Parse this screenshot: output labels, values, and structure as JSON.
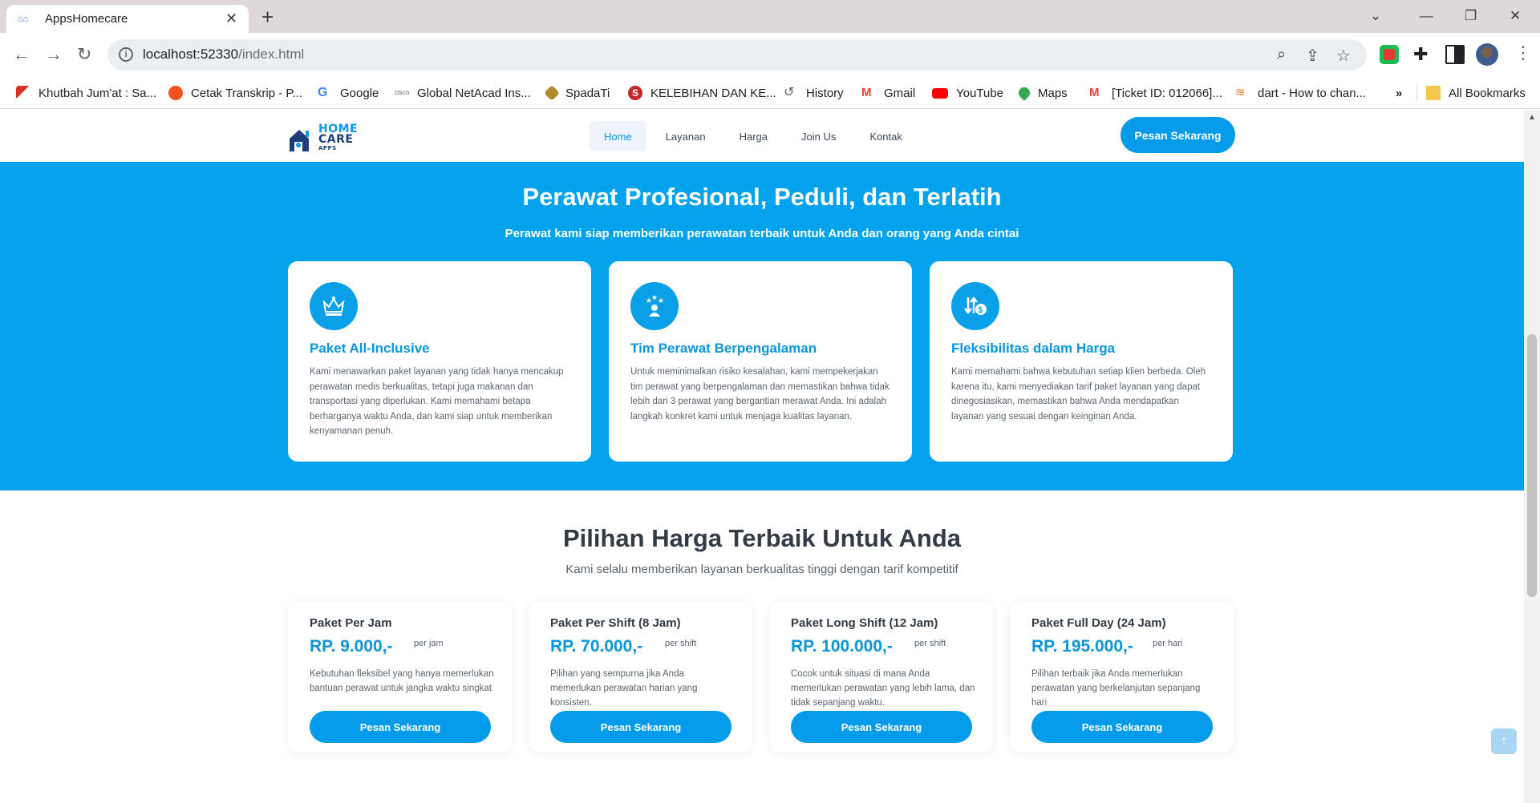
{
  "browser": {
    "tab_title": "AppsHomecare",
    "tab_favicon": "homecare-favicon",
    "url_host": "localhost:52330",
    "url_path": "/index.html",
    "bookmarks": [
      {
        "label": "Khutbah Jum'at : Sa...",
        "icon": "red-arrow-icon",
        "color": "#d93025"
      },
      {
        "label": "Cetak Transkrip - P...",
        "icon": "orange-box-icon",
        "color": "#f4511e"
      },
      {
        "label": "Google",
        "icon": "google-icon",
        "color": "#4285f4"
      },
      {
        "label": "Global NetAcad Ins...",
        "icon": "cisco-icon",
        "color": "#5f6368"
      },
      {
        "label": "SpadaTi",
        "icon": "spadati-icon",
        "color": "#b08a2e"
      },
      {
        "label": "KELEBIHAN DAN KE...",
        "icon": "s-circle-icon",
        "color": "#c62828"
      },
      {
        "label": "History",
        "icon": "history-icon",
        "color": "#5f6368"
      },
      {
        "label": "Gmail",
        "icon": "gmail-icon",
        "color": "#ea4335"
      },
      {
        "label": "YouTube",
        "icon": "youtube-icon",
        "color": "#ff0000"
      },
      {
        "label": "Maps",
        "icon": "maps-icon",
        "color": "#34a853"
      },
      {
        "label": "[Ticket ID: 012066]...",
        "icon": "gmail-icon",
        "color": "#ea4335"
      },
      {
        "label": "dart - How to chan...",
        "icon": "stackoverflow-icon",
        "color": "#f48024"
      }
    ],
    "overflow": "»",
    "all_bookmarks": "All Bookmarks"
  },
  "site": {
    "logo_line1": "HOME",
    "logo_line2": "CARE",
    "logo_line3": "APPS",
    "menu": [
      "Home",
      "Layanan",
      "Harga",
      "Join Us",
      "Kontak"
    ],
    "cta": "Pesan Sekarang"
  },
  "hero": {
    "title": "Perawat Profesional, Peduli, dan Terlatih",
    "subtitle": "Perawat kami siap memberikan perawatan terbaik untuk Anda dan orang yang Anda cintai",
    "features": [
      {
        "icon": "crown-icon",
        "title": "Paket All-Inclusive",
        "text": "Kami menawarkan paket layanan yang tidak hanya mencakup perawatan medis berkualitas, tetapi juga makanan dan transportasi yang diperlukan. Kami memahami betapa berharganya waktu Anda, dan kami siap untuk memberikan kenyamanan penuh."
      },
      {
        "icon": "team-stars-icon",
        "title": "Tim Perawat Berpengalaman",
        "text": "Untuk meminimalkan risiko kesalahan, kami mempekerjakan tim perawat yang berpengalaman dan memastikan bahwa tidak lebih dari 3 perawat yang bergantian merawat Anda. Ini adalah langkah konkret kami untuk menjaga kualitas layanan."
      },
      {
        "icon": "price-arrows-icon",
        "title": "Fleksibilitas dalam Harga",
        "text": "Kami memahami bahwa kebutuhan setiap klien berbeda. Oleh karena itu, kami menyediakan tarif paket layanan yang dapat dinegosiasikan, memastikan bahwa Anda mendapatkan layanan yang sesuai dengan keinginan Anda."
      }
    ]
  },
  "pricing": {
    "title": "Pilihan Harga Terbaik Untuk Anda",
    "subtitle": "Kami selalu memberikan layanan berkualitas tinggi dengan tarif kompetitif",
    "plans": [
      {
        "name": "Paket Per Jam",
        "price": "RP. 9.000,-",
        "unit": "per jam",
        "desc": "Kebutuhan fleksibel yang hanya memerlukan bantuan perawat untuk jangka waktu singkat",
        "button": "Pesan Sekarang"
      },
      {
        "name": "Paket Per Shift (8 Jam)",
        "price": "RP. 70.000,-",
        "unit": "per shift",
        "desc": "Pilihan yang sempurna jika Anda memerlukan perawatan harian yang konsisten.",
        "button": "Pesan Sekarang"
      },
      {
        "name": "Paket Long Shift (12 Jam)",
        "price": "RP. 100.000,-",
        "unit": "per shift",
        "desc": "Cocok untuk situasi di mana Anda memerlukan perawatan yang lebih lama, dan tidak sepanjang waktu.",
        "button": "Pesan Sekarang"
      },
      {
        "name": "Paket Full Day (24 Jam)",
        "price": "RP. 195.000,-",
        "unit": "per hari",
        "desc": "Pilihan terbaik jika Anda memerlukan perawatan yang berkelanjutan sepanjang hari",
        "button": "Pesan Sekarang"
      }
    ]
  },
  "colors": {
    "brand": "#049bea",
    "hero_bg": "#02a3ec",
    "heading": "#333b45"
  }
}
